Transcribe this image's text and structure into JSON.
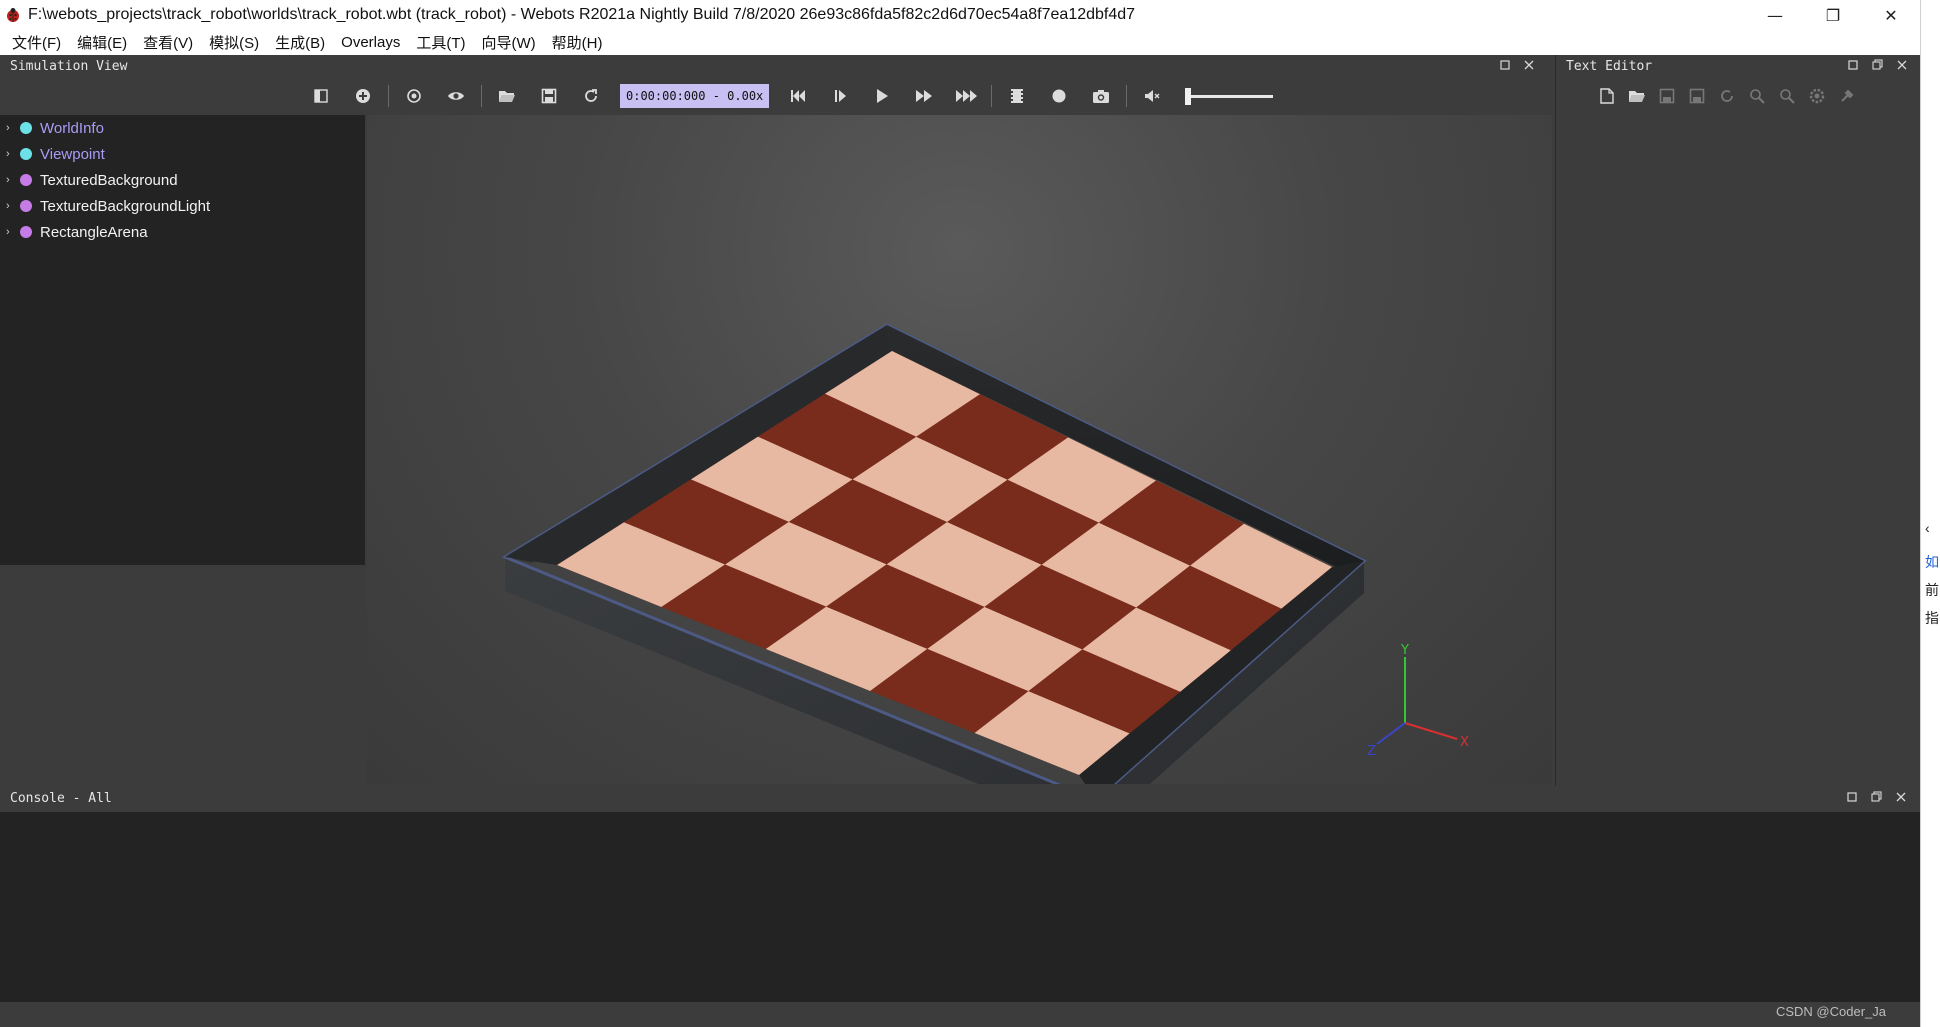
{
  "window": {
    "title": "F:\\webots_projects\\track_robot\\worlds\\track_robot.wbt (track_robot) - Webots R2021a Nightly Build 7/8/2020 26e93c86fda5f82c2d6d70ec54a8f7ea12dbf4d7",
    "minimize": "—",
    "restore": "❐",
    "close": "✕"
  },
  "menu": [
    "文件(F)",
    "编辑(E)",
    "查看(V)",
    "模拟(S)",
    "生成(B)",
    "Overlays",
    "工具(T)",
    "向导(W)",
    "帮助(H)"
  ],
  "simulation_view": {
    "title": "Simulation View",
    "time_display": "0:00:00:000  - 0.00x"
  },
  "scene_tree": [
    {
      "label": "WorldInfo",
      "color": "#a99cf5",
      "dot": "#6de1e8"
    },
    {
      "label": "Viewpoint",
      "color": "#a99cf5",
      "dot": "#6de1e8"
    },
    {
      "label": "TexturedBackground",
      "color": "#f2f2f2",
      "dot": "#c67ce6"
    },
    {
      "label": "TexturedBackgroundLight",
      "color": "#f2f2f2",
      "dot": "#c67ce6"
    },
    {
      "label": "RectangleArena",
      "color": "#f2f2f2",
      "dot": "#c67ce6"
    }
  ],
  "axes": {
    "y": "Y",
    "x": "X",
    "z": "Z"
  },
  "text_editor": {
    "title": "Text Editor"
  },
  "console": {
    "title": "Console - All"
  },
  "right_strip": [
    "‹",
    "如",
    "前",
    "指"
  ],
  "watermark": "CSDN @Coder_Ja",
  "colors": {
    "panel": "#3c3c3c",
    "tree_bg": "#232323",
    "time_box": "#c8c0f2"
  }
}
